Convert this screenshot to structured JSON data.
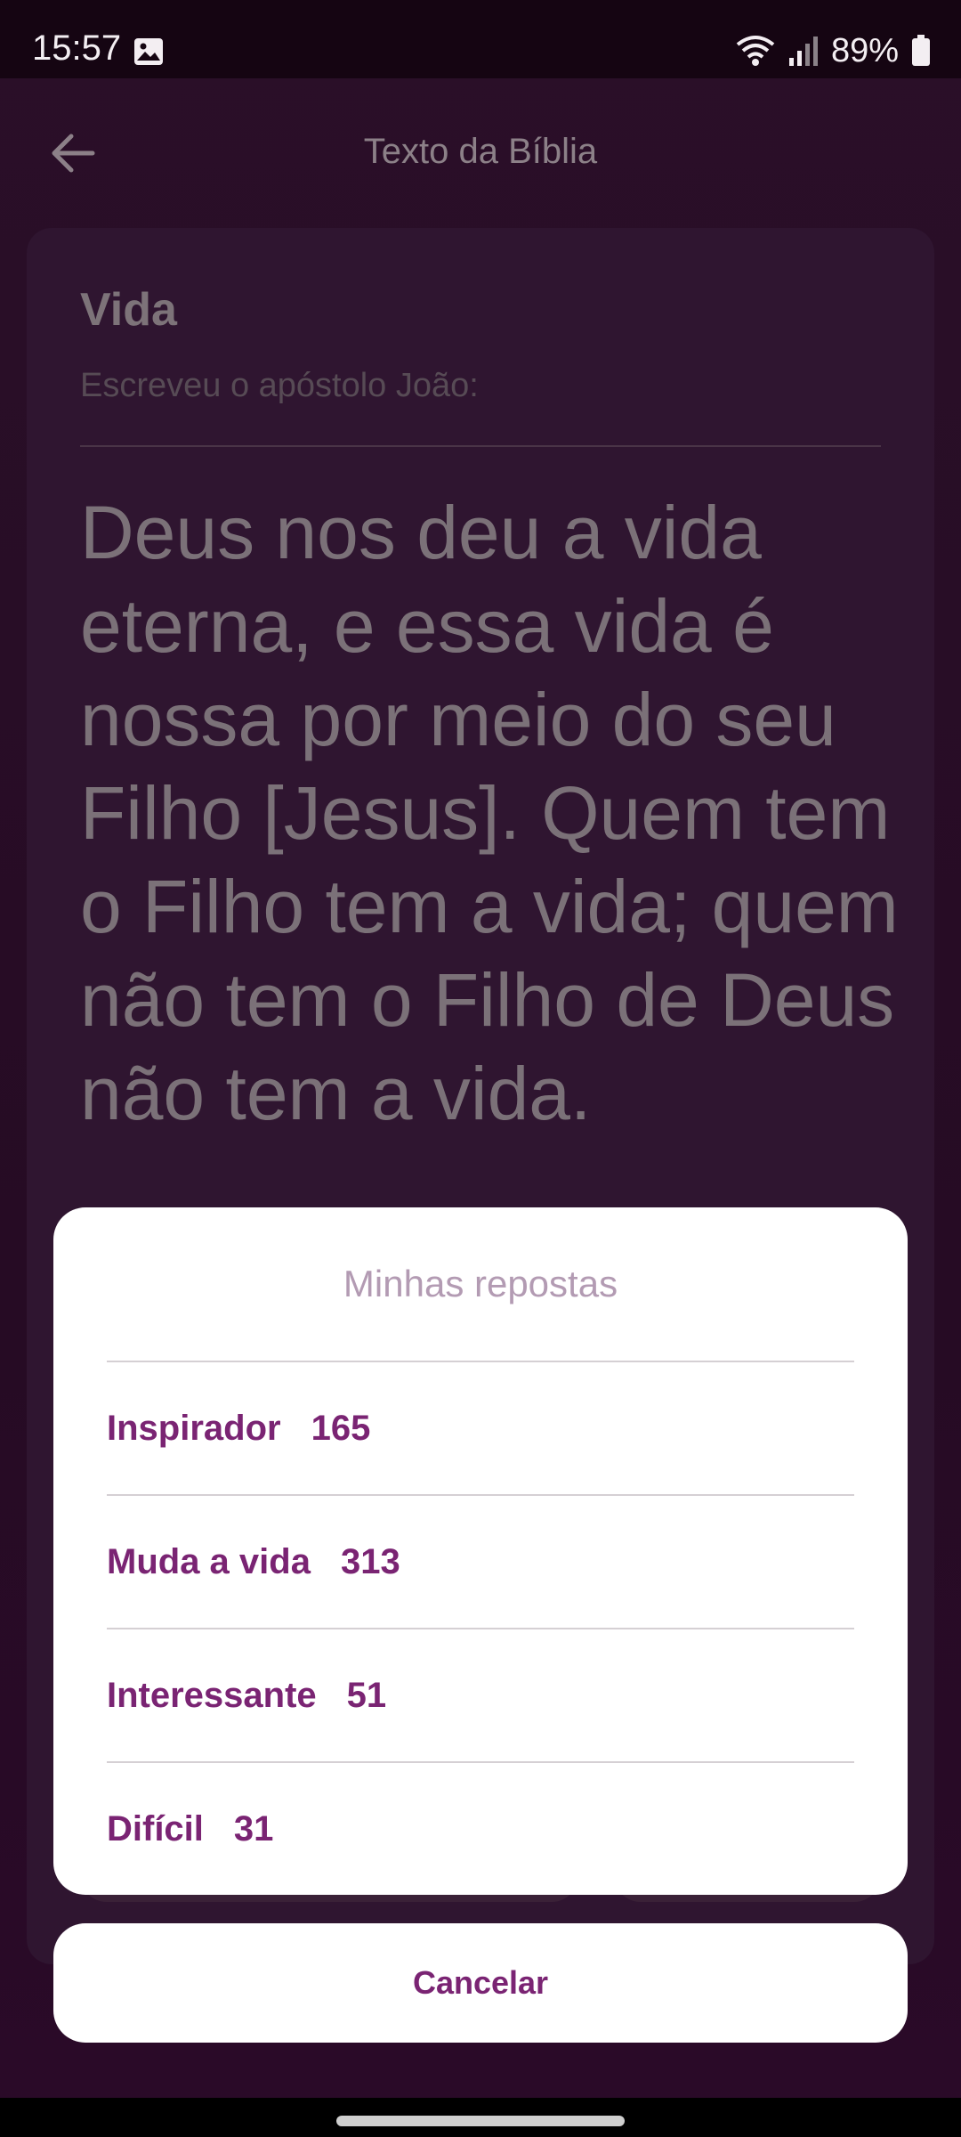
{
  "status_bar": {
    "time": "15:57",
    "battery": "89%",
    "icons": [
      "gallery-icon",
      "wifi-icon",
      "signal-icon",
      "battery-icon"
    ]
  },
  "header": {
    "title": "Texto da Bíblia",
    "back_icon": "arrow-left-icon"
  },
  "verse": {
    "topic": "Vida",
    "intro": "Escreveu o apóstolo João:",
    "text": "Deus nos deu a vida eterna, e essa vida é nossa por meio do seu Filho [Jesus]. Quem tem o Filho tem a vida; quem não tem o Filho de Deus não tem a vida."
  },
  "sheet": {
    "title": "Minhas repostas",
    "options": [
      {
        "label": "Inspirador",
        "count": "165"
      },
      {
        "label": "Muda a vida",
        "count": "313"
      },
      {
        "label": "Interessante",
        "count": "51"
      },
      {
        "label": "Difícil",
        "count": "31"
      }
    ],
    "cancel_label": "Cancelar"
  },
  "colors": {
    "accent": "#7a2473",
    "sheet_title": "#b39bb3",
    "background": "#260b24"
  }
}
